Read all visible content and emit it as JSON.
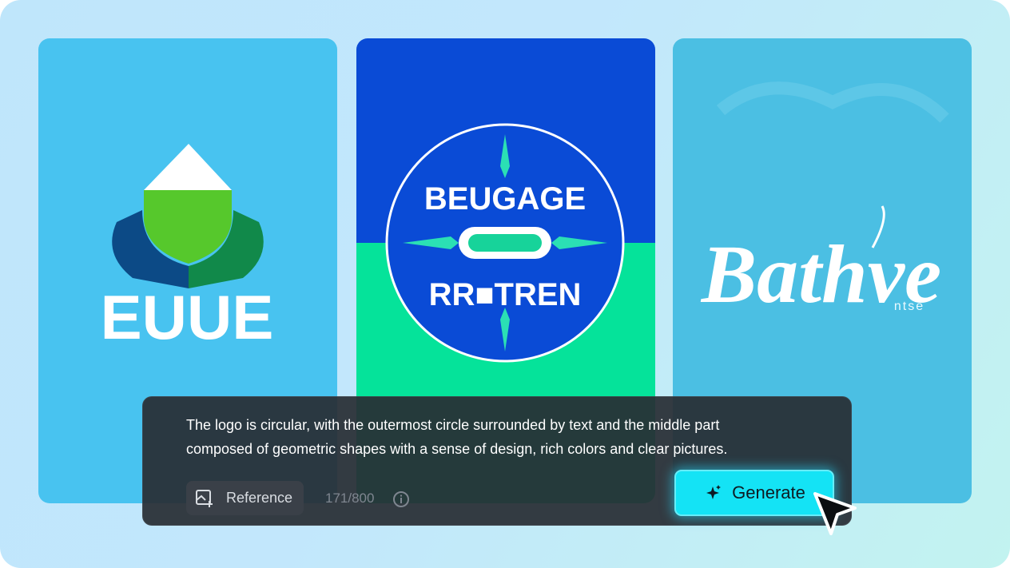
{
  "cards": [
    {
      "logo_text": "EUUE"
    },
    {
      "logo_text_top": "BEUGAGE",
      "logo_text_bottom": "RR■TREN"
    },
    {
      "logo_text": "Bathve",
      "logo_subtext": "ntse"
    }
  ],
  "panel": {
    "prompt_line1": "The logo is circular, with the outermost circle surrounded by text and the middle part",
    "prompt_line2": "composed of geometric shapes with a sense of design, rich colors and clear pictures.",
    "reference_label": "Reference",
    "char_count": "171/800",
    "generate_label": "Generate"
  },
  "icons": {
    "reference": "image-add-icon",
    "info": "info-icon",
    "generate": "sparkle-icon",
    "cursor": "cursor-arrow-icon"
  },
  "colors": {
    "accent": "#14e3f5",
    "panel_bg": "#282d34",
    "card1_bg": "#48c3f0",
    "card2_top": "#0a4bd6",
    "card2_bottom": "#05e39a",
    "card3_bg": "#4bbfe3"
  }
}
